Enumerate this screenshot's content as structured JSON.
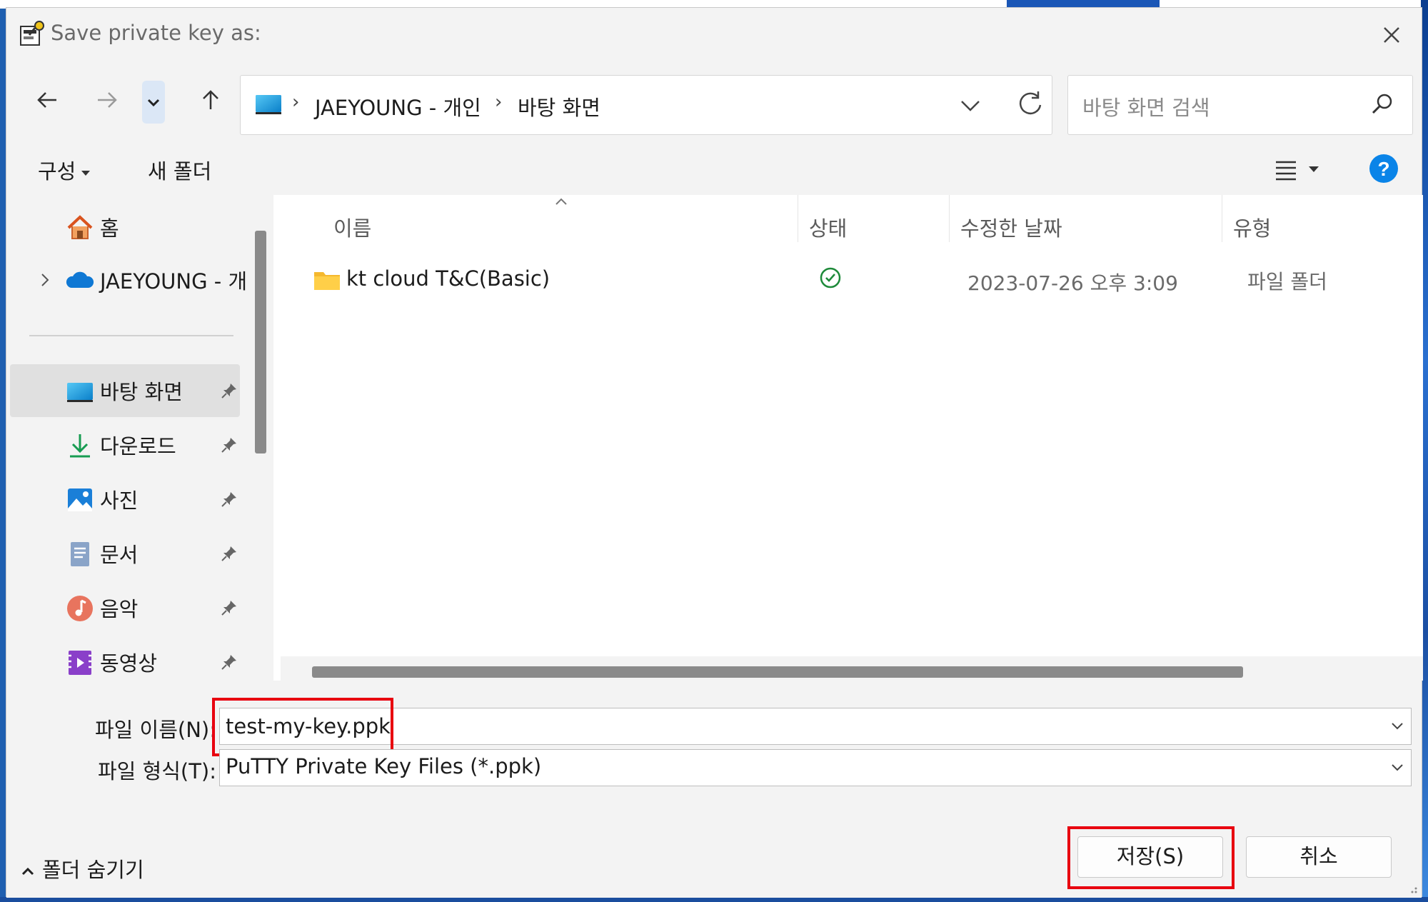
{
  "window": {
    "title": "Save private key as:"
  },
  "navigation": {
    "breadcrumb": [
      "JAEYOUNG - 개인",
      "바탕 화면"
    ],
    "separator": "›",
    "search_placeholder": "바탕 화면 검색"
  },
  "toolbar": {
    "organize_label": "구성",
    "new_folder_label": "새 폴더"
  },
  "sidebar": {
    "items": [
      {
        "label": "홈",
        "icon": "home-icon"
      },
      {
        "label": "JAEYOUNG - 개",
        "icon": "onedrive-cloud-icon",
        "expandable": true
      },
      {
        "label": "바탕 화면",
        "icon": "desktop-icon",
        "pinned": true,
        "selected": true
      },
      {
        "label": "다운로드",
        "icon": "download-icon",
        "pinned": true
      },
      {
        "label": "사진",
        "icon": "pictures-icon",
        "pinned": true
      },
      {
        "label": "문서",
        "icon": "documents-icon",
        "pinned": true
      },
      {
        "label": "음악",
        "icon": "music-icon",
        "pinned": true
      },
      {
        "label": "동영상",
        "icon": "videos-icon",
        "pinned": true
      }
    ]
  },
  "file_list": {
    "columns": [
      "이름",
      "상태",
      "수정한 날짜",
      "유형"
    ],
    "rows": [
      {
        "name": "kt cloud T&C(Basic)",
        "status_icon": "synced-check-icon",
        "modified": "2023-07-26 오후 3:09",
        "type": "파일 폴더"
      }
    ]
  },
  "fields": {
    "filename_label": "파일 이름(N):",
    "filename_value": "test-my-key.ppk",
    "filetype_label": "파일 형식(T):",
    "filetype_value": "PuTTY Private Key Files (*.ppk)"
  },
  "footer": {
    "hide_folders_label": "폴더 숨기기",
    "save_label": "저장(S)",
    "cancel_label": "취소"
  },
  "colors": {
    "accent": "#0067c0",
    "highlight": "#e8000f",
    "selected_bg": "#e0e0e0"
  }
}
